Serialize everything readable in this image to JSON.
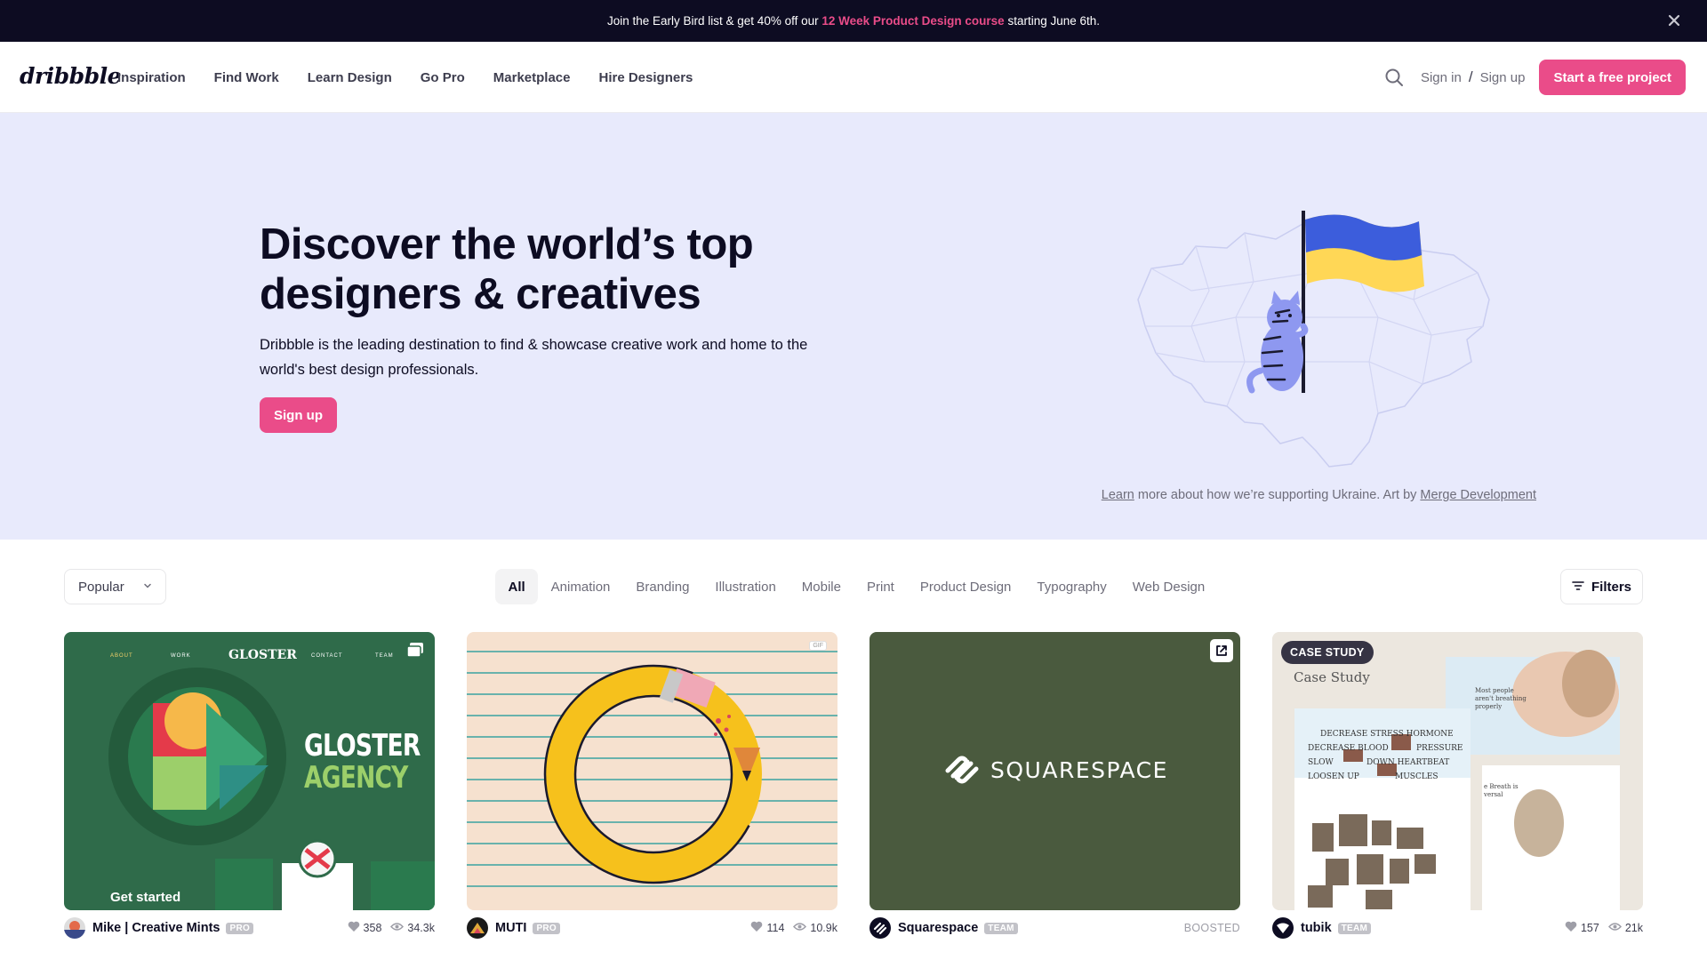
{
  "promo": {
    "text_before": "Join the Early Bird list & get 40% off our ",
    "highlight": "12 Week Product Design course",
    "text_after": " starting June 6th."
  },
  "nav": {
    "logo": "dribbble",
    "links": [
      "Inspiration",
      "Find Work",
      "Learn Design",
      "Go Pro",
      "Marketplace",
      "Hire Designers"
    ],
    "sign_in": "Sign in",
    "separator": "/",
    "sign_up": "Sign up",
    "cta": "Start a free project"
  },
  "hero": {
    "title": "Discover the world’s top designers & creatives",
    "subtitle": "Dribbble is the leading destination to find & showcase creative work and home to the world's best design professionals.",
    "signup": "Sign up",
    "credit_link1": "Learn",
    "credit_text": " more about how we’re supporting Ukraine. Art by ",
    "credit_link2": "Merge Development"
  },
  "filters": {
    "sort": "Popular",
    "categories": [
      "All",
      "Animation",
      "Branding",
      "Illustration",
      "Mobile",
      "Print",
      "Product Design",
      "Typography",
      "Web Design"
    ],
    "active": "All",
    "filters_label": "Filters"
  },
  "shots": [
    {
      "author": "Mike | Creative Mints",
      "badge": "PRO",
      "likes": "358",
      "views": "34.3k",
      "thumb_text": {
        "brand": "GLOSTER",
        "headline1": "GLOSTER",
        "headline2": "AGENCY",
        "menu": [
          "ABOUT",
          "WORK",
          "CONTACT",
          "TEAM"
        ],
        "cta": "Get started"
      }
    },
    {
      "author": "MUTI",
      "badge": "PRO",
      "likes": "114",
      "views": "10.9k",
      "thumb_text": {
        "gif": "GIF"
      }
    },
    {
      "author": "Squarespace",
      "badge": "TEAM",
      "label": "BOOSTED",
      "thumb_text": {
        "brand": "SQUARESPACE"
      }
    },
    {
      "author": "tubik",
      "badge": "TEAM",
      "likes": "157",
      "views": "21k",
      "thumb_text": {
        "case_badge": "CASE STUDY",
        "case_title": "Case Study",
        "lines": [
          "DECREASE STRESS HORMONE",
          "DECREASE BLOOD",
          "PRESSURE",
          "SLOW",
          "DOWN HEARTBEAT",
          "LOOSEN UP",
          "MUSCLES"
        ],
        "side_note": "Most people aren't breathing properly",
        "side_note2": "e Breath is versal"
      }
    }
  ],
  "colors": {
    "accent": "#ea4c89",
    "dark": "#0d0c22",
    "hero_bg": "#e8eafc"
  }
}
